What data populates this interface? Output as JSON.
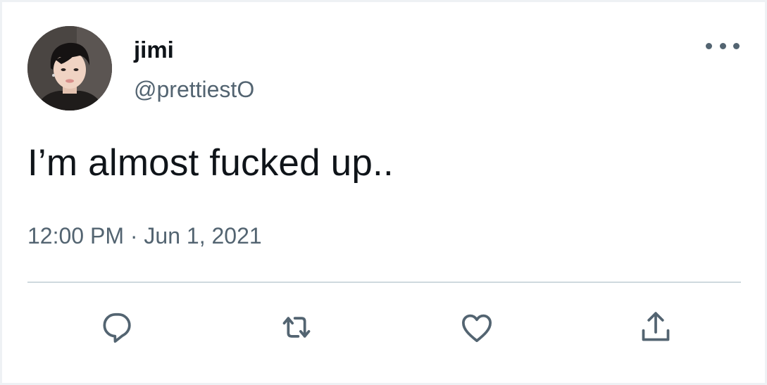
{
  "tweet": {
    "display_name": "jimi",
    "handle": "@prettiestO",
    "text": "I’m almost fucked up..",
    "timestamp": "12:00 PM · Jun 1, 2021"
  },
  "icons": {
    "avatar": "profile-photo",
    "more": "more-options-icon",
    "reply": "reply-icon",
    "retweet": "retweet-icon",
    "like": "heart-icon",
    "share": "share-icon"
  },
  "colors": {
    "text_primary": "#0f1419",
    "text_secondary": "#536471",
    "divider": "#cfd9de",
    "icon": "#536471",
    "background": "#ffffff"
  }
}
